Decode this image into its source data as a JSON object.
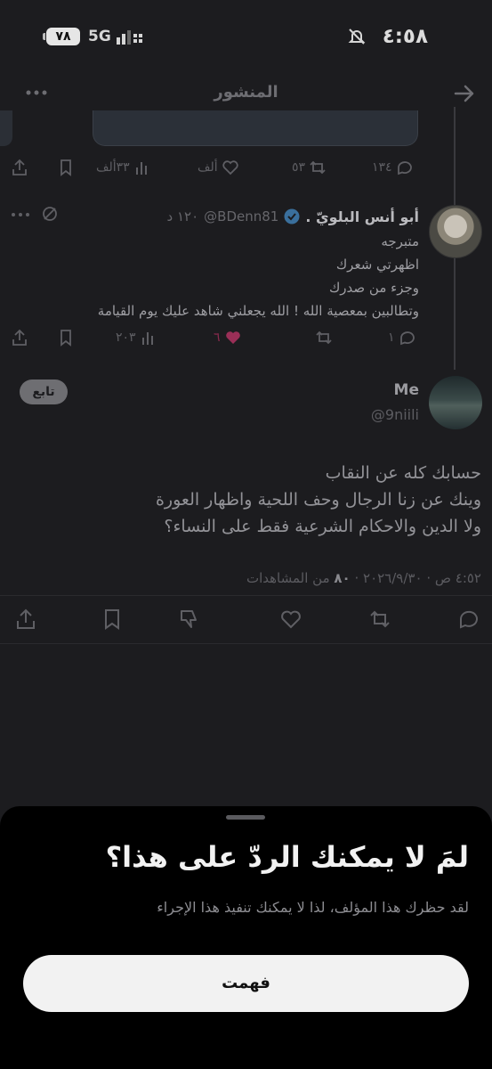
{
  "status_bar": {
    "time": "٤:٥٨",
    "battery": "٧٨",
    "network": "5G"
  },
  "nav": {
    "title": "المنشور"
  },
  "prev_actions": {
    "views": "٣٣ألف",
    "likes": "ألف",
    "reposts": "٥٣",
    "replies": "١٣٤"
  },
  "reply": {
    "name": "أبو أنس البلويّ .",
    "handle": "@BDenn81",
    "time": "١٢٠ د",
    "lines": [
      "متبرجه",
      "اظهرتي شعرك",
      "وجزء من صدرك",
      "وتطالبين بمعصية الله ! الله يجعلني شاهد عليك يوم القيامة"
    ],
    "views": "٢٠٣",
    "likes": "٦",
    "replies": "١"
  },
  "main": {
    "name": "Me",
    "handle": "@9niili",
    "follow_label": "تابع",
    "lines": [
      "حسابك كله عن النقاب",
      "وينك عن زنا الرجال وحف اللحية واظهار العورة",
      "ولا الدين والاحكام الشرعية فقط  على النساء؟"
    ],
    "timestamp": "٤:٥٢ ص · ٢٠٢٦/٩/٣٠ · ",
    "views_count": "٨٠",
    "views_label": " من المشاهدات"
  },
  "sheet": {
    "title": "لمَ لا يمكنك الردّ على هذا؟",
    "body": "لقد حظرك هذا المؤلف، لذا لا يمكنك تنفيذ هذا الإجراء",
    "button": "فهمت"
  },
  "colors": {
    "like_pink": "#d9306f",
    "verified_blue": "#1d9bf0"
  }
}
